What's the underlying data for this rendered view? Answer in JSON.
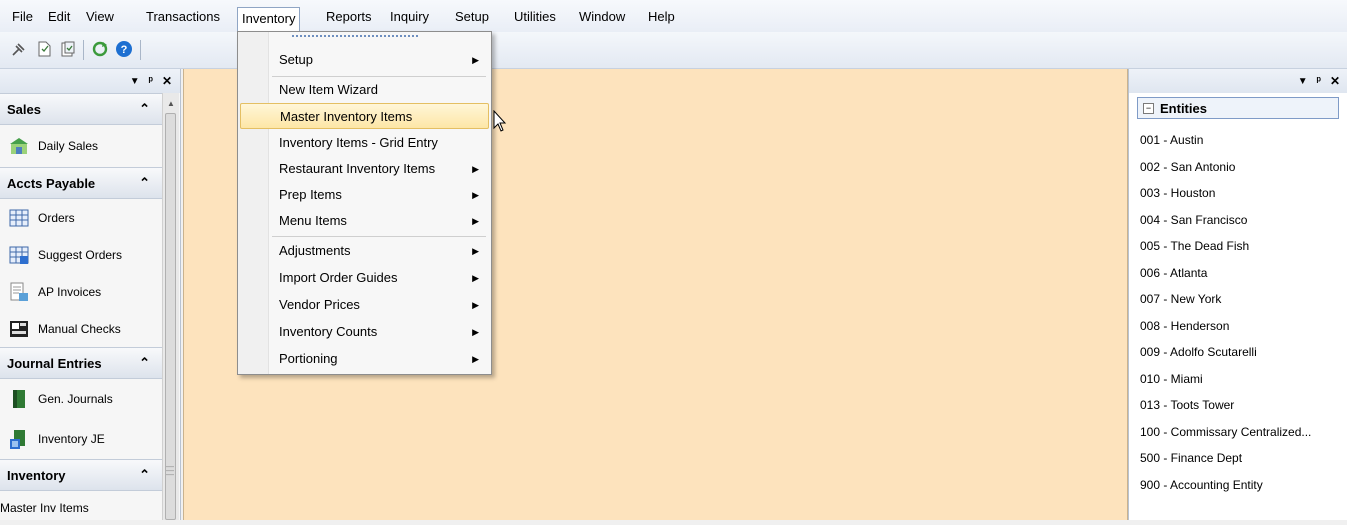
{
  "menubar": {
    "items": [
      "File",
      "Edit",
      "View",
      "Transactions",
      "Inventory",
      "Reports",
      "Inquiry",
      "Setup",
      "Utilities",
      "Window",
      "Help"
    ]
  },
  "toolbar": {
    "buttons": [
      "pin-tool-icon",
      "new-document-icon",
      "copy-document-icon",
      "refresh-icon",
      "help-icon"
    ]
  },
  "left_panel": {
    "header_controls": [
      "▾",
      "ᵖ",
      "✕"
    ],
    "groups": [
      {
        "title": "Sales",
        "items": [
          {
            "label": "Daily Sales",
            "icon": "shop-icon"
          }
        ]
      },
      {
        "title": "Accts Payable",
        "items": [
          {
            "label": "Orders",
            "icon": "grid-icon"
          },
          {
            "label": "Suggest Orders",
            "icon": "suggest-grid-icon"
          },
          {
            "label": "AP Invoices",
            "icon": "invoice-icon"
          },
          {
            "label": "Manual Checks",
            "icon": "check-icon"
          }
        ]
      },
      {
        "title": "Journal Entries",
        "items": [
          {
            "label": "Gen. Journals",
            "icon": "journal-icon"
          },
          {
            "label": "Inventory JE",
            "icon": "inventory-je-icon"
          }
        ]
      },
      {
        "title": "Inventory",
        "items": [
          {
            "label": "Master Inv Items",
            "icon": ""
          }
        ]
      }
    ]
  },
  "dropdown": {
    "open_menu": "Inventory",
    "items": [
      {
        "label": "Setup",
        "submenu": true
      },
      {
        "label": "New Item Wizard",
        "submenu": false
      },
      {
        "label": "Master Inventory Items",
        "submenu": false,
        "highlighted": true
      },
      {
        "label": "Inventory Items - Grid Entry",
        "submenu": false
      },
      {
        "label": "Restaurant Inventory Items",
        "submenu": true
      },
      {
        "label": "Prep Items",
        "submenu": true
      },
      {
        "label": "Menu Items",
        "submenu": true
      },
      {
        "label": "Adjustments",
        "submenu": true
      },
      {
        "label": "Import Order Guides",
        "submenu": true
      },
      {
        "label": "Vendor Prices",
        "submenu": true
      },
      {
        "label": "Inventory Counts",
        "submenu": true
      },
      {
        "label": "Portioning",
        "submenu": true
      }
    ]
  },
  "right_panel": {
    "title": "Entities",
    "entities": [
      "001 - Austin",
      "002 - San Antonio",
      "003 - Houston",
      "004 - San Francisco",
      "005 - The Dead Fish",
      "006 - Atlanta",
      "007 - New York",
      "008 - Henderson",
      "009 - Adolfo Scutarelli",
      "010 - Miami",
      "013 - Toots Tower",
      "100 - Commissary Centralized...",
      "500 - Finance Dept",
      "900 - Accounting Entity"
    ]
  },
  "colors": {
    "mdi_background": "#fde3bd",
    "highlight": "#fde6a6",
    "highlight_border": "#e4bf63"
  }
}
